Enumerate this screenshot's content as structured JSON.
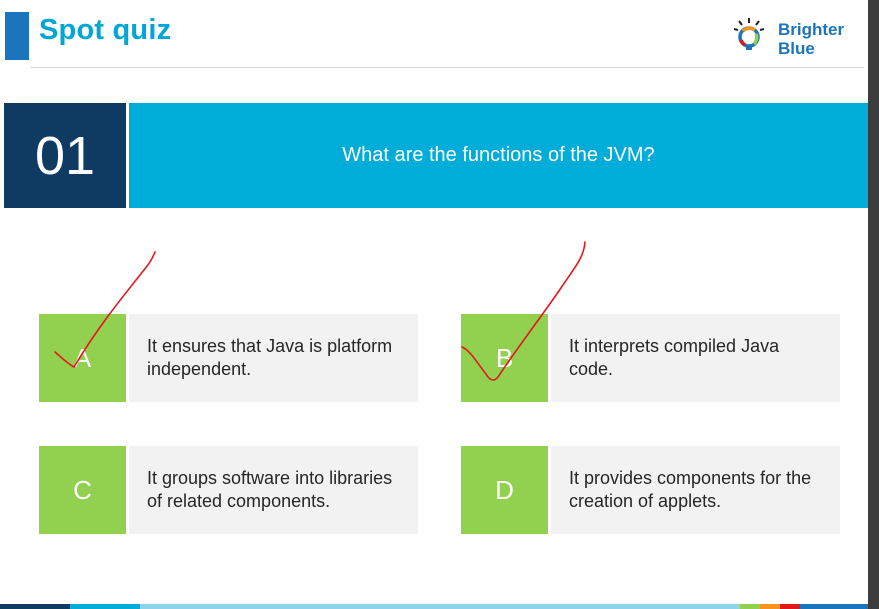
{
  "header": {
    "title": "Spot quiz",
    "logo": {
      "line1": "Brighter",
      "line2": "Blue"
    }
  },
  "question": {
    "number": "01",
    "text": "What are the functions of the JVM?"
  },
  "options": [
    {
      "letter": "A",
      "text": "It ensures that Java is platform independent.",
      "checked": true
    },
    {
      "letter": "B",
      "text": "It interprets compiled Java code.",
      "checked": true
    },
    {
      "letter": "C",
      "text": "It groups software into libraries of related components.",
      "checked": false
    },
    {
      "letter": "D",
      "text": "It provides components for the creation of applets.",
      "checked": false
    }
  ],
  "colors": {
    "title": "#00a6d6",
    "number_bg": "#0f3b63",
    "question_bg": "#00acd8",
    "letter_bg": "#92d050",
    "option_bg": "#f2f2f2",
    "check_mark": "#e0191c"
  }
}
